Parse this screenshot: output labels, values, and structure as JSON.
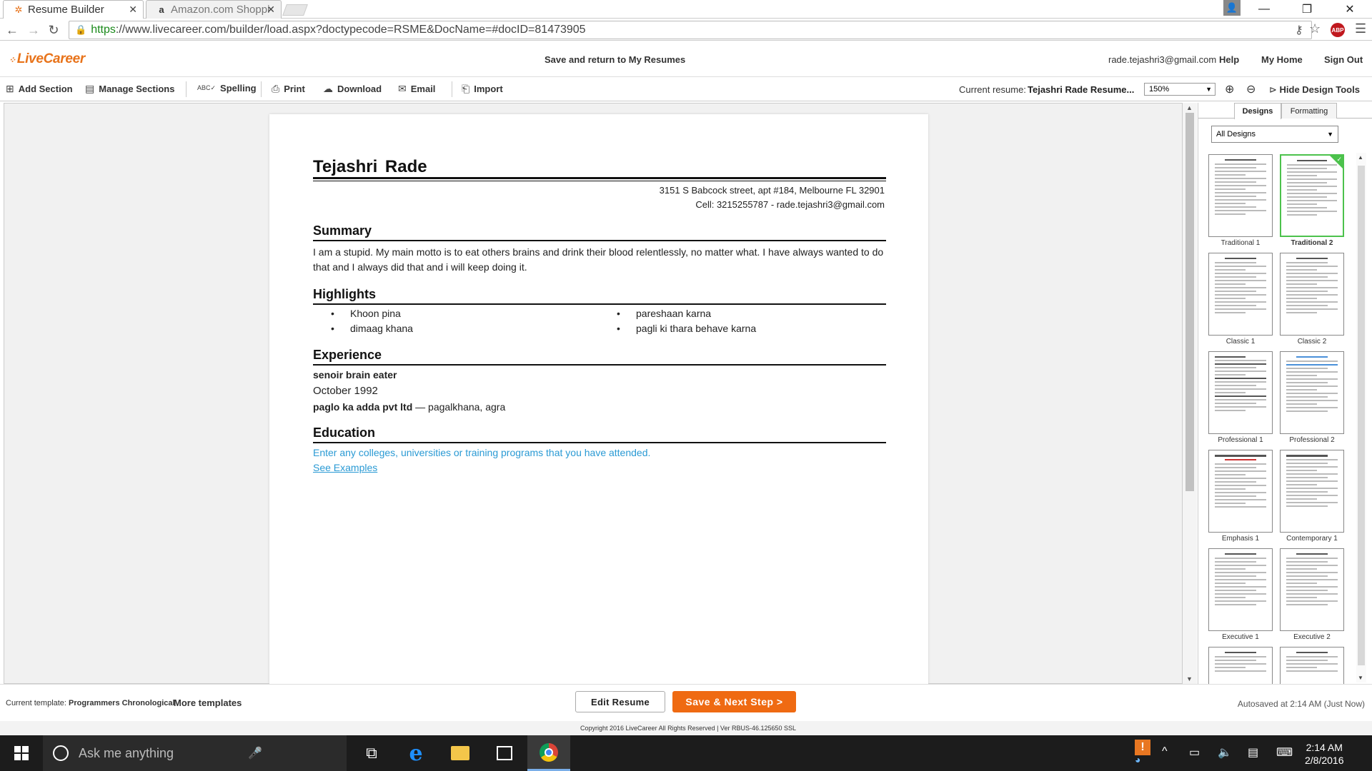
{
  "browser": {
    "tabs": [
      {
        "label": "Resume Builder",
        "favicon": "livecareer-icon"
      },
      {
        "label": "Amazon.com Shoppi",
        "favicon": "amazon-icon"
      }
    ],
    "url_https": "https",
    "url_rest": "://www.livecareer.com/builder/load.aspx?doctypecode=RSME&DocName=#docID=81473905"
  },
  "header": {
    "logo": "LiveCareer",
    "save_return": "Save and return to My Resumes",
    "email": "rade.tejashri3@gmail.com",
    "links": [
      "Help",
      "My Home",
      "Sign Out"
    ]
  },
  "toolbar": {
    "add_section": "Add Section",
    "manage_sections": "Manage Sections",
    "spelling": "Spelling",
    "print": "Print",
    "download": "Download",
    "email": "Email",
    "import": "Import",
    "current_resume_label": "Current resume:",
    "current_resume_name": "Tejashri Rade Resume...",
    "zoom": "150%",
    "hide_design_tools": "Hide Design Tools"
  },
  "resume": {
    "name": "Tejashri  Rade",
    "address": "3151 S Babcock street, apt #184, Melbourne FL 32901",
    "contact": "Cell: 3215255787 - rade.tejashri3@gmail.com",
    "summary_heading": "Summary",
    "summary_text": "I am a stupid. My main motto is to eat others brains and drink their blood relentlessly, no matter what. I have always wanted to do that and I always did that and i will keep doing it.",
    "highlights_heading": "Highlights",
    "highlights": [
      "Khoon pina",
      "pareshaan karna",
      "dimaag khana",
      "pagli ki thara behave karna"
    ],
    "experience_heading": "Experience",
    "job_title": "senoir brain eater",
    "job_date": "October 1992",
    "company": "paglo ka adda pvt ltd",
    "company_location": " — pagalkhana, agra",
    "education_heading": "Education",
    "education_prompt": "Enter any colleges, universities or training programs that you have attended.",
    "see_examples": "See Examples"
  },
  "design_panel": {
    "tabs": [
      "Designs",
      "Formatting"
    ],
    "filter": "All Designs",
    "designs": [
      "Traditional 1",
      "Traditional 2",
      "Classic 1",
      "Classic 2",
      "Professional 1",
      "Professional 2",
      "Emphasis 1",
      "Contemporary 1",
      "Executive 1",
      "Executive 2"
    ],
    "selected": "Traditional 2"
  },
  "footer": {
    "current_template_label": "Current template:",
    "current_template": "Programmers Chronological",
    "more_templates": "More templates",
    "edit_resume": "Edit Resume",
    "save_next": "Save & Next Step >",
    "autosaved": "Autosaved at 2:14 AM (Just Now)",
    "copyright": "Copyright  2016 LiveCareer All Rights Reserved  |  Ver RBUS-46.125650 SSL"
  },
  "taskbar": {
    "search_placeholder": "Ask me anything",
    "time": "2:14 AM",
    "date": "2/8/2016"
  },
  "colors": {
    "brand_orange": "#ef6a12",
    "link_blue": "#2a9ad4",
    "selected_green": "#4cc24c"
  }
}
